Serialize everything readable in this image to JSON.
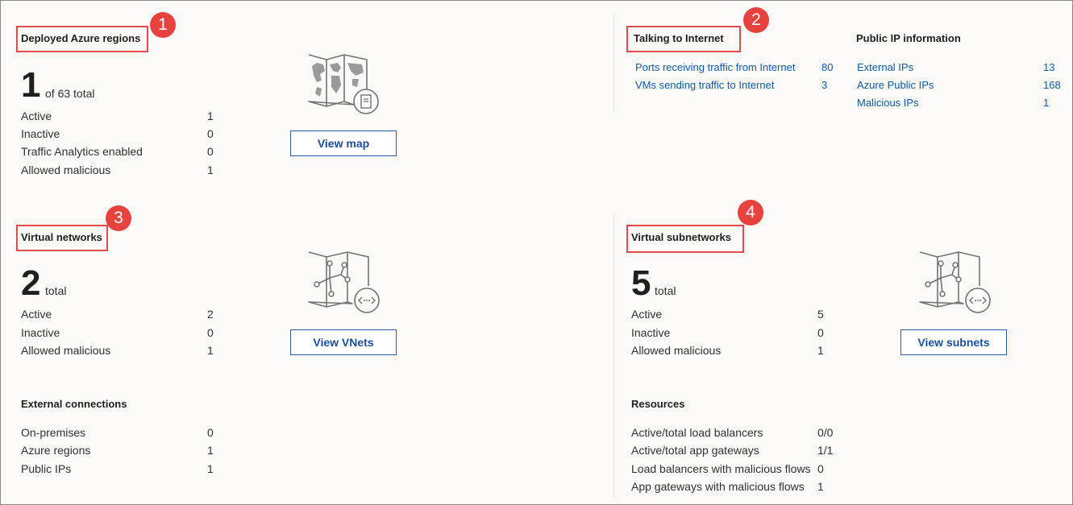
{
  "regions": {
    "title": "Deployed Azure regions",
    "badge": "1",
    "count": "1",
    "suffix": "of 63 total",
    "rows": [
      {
        "label": "Active",
        "value": "1"
      },
      {
        "label": "Inactive",
        "value": "0"
      },
      {
        "label": "Traffic Analytics enabled",
        "value": "0"
      },
      {
        "label": "Allowed malicious",
        "value": "1"
      }
    ],
    "button": "View map",
    "icon": "world-map-icon"
  },
  "internet": {
    "title": "Talking to Internet",
    "badge": "2",
    "rows": [
      {
        "label": "Ports receiving traffic from Internet",
        "value": "80"
      },
      {
        "label": "VMs sending traffic to Internet",
        "value": "3"
      }
    ]
  },
  "public_ip": {
    "title": "Public IP information",
    "rows": [
      {
        "label": "External IPs",
        "value": "13"
      },
      {
        "label": "Azure Public IPs",
        "value": "168"
      },
      {
        "label": "Malicious IPs",
        "value": "1"
      }
    ]
  },
  "vnets": {
    "title": "Virtual networks",
    "badge": "3",
    "count": "2",
    "suffix": "total",
    "rows": [
      {
        "label": "Active",
        "value": "2"
      },
      {
        "label": "Inactive",
        "value": "0"
      },
      {
        "label": "Allowed malicious",
        "value": "1"
      }
    ],
    "button": "View VNets",
    "icon": "network-map-icon"
  },
  "external": {
    "title": "External connections",
    "rows": [
      {
        "label": "On-premises",
        "value": "0"
      },
      {
        "label": "Azure regions",
        "value": "1"
      },
      {
        "label": "Public IPs",
        "value": "1"
      }
    ]
  },
  "subnets": {
    "title": "Virtual subnetworks",
    "badge": "4",
    "count": "5",
    "suffix": "total",
    "rows": [
      {
        "label": "Active",
        "value": "5"
      },
      {
        "label": "Inactive",
        "value": "0"
      },
      {
        "label": "Allowed malicious",
        "value": "1"
      }
    ],
    "button": "View subnets",
    "icon": "subnet-map-icon"
  },
  "resources": {
    "title": "Resources",
    "rows": [
      {
        "label": "Active/total load balancers",
        "value": "0/0"
      },
      {
        "label": "Active/total app gateways",
        "value": "1/1"
      },
      {
        "label": "Load balancers with malicious flows",
        "value": "0"
      },
      {
        "label": "App gateways with malicious flows",
        "value": "1"
      }
    ]
  },
  "colors": {
    "accent": "#0f5ba7",
    "highlight": "#e04b4b",
    "badge": "#e8423f"
  }
}
